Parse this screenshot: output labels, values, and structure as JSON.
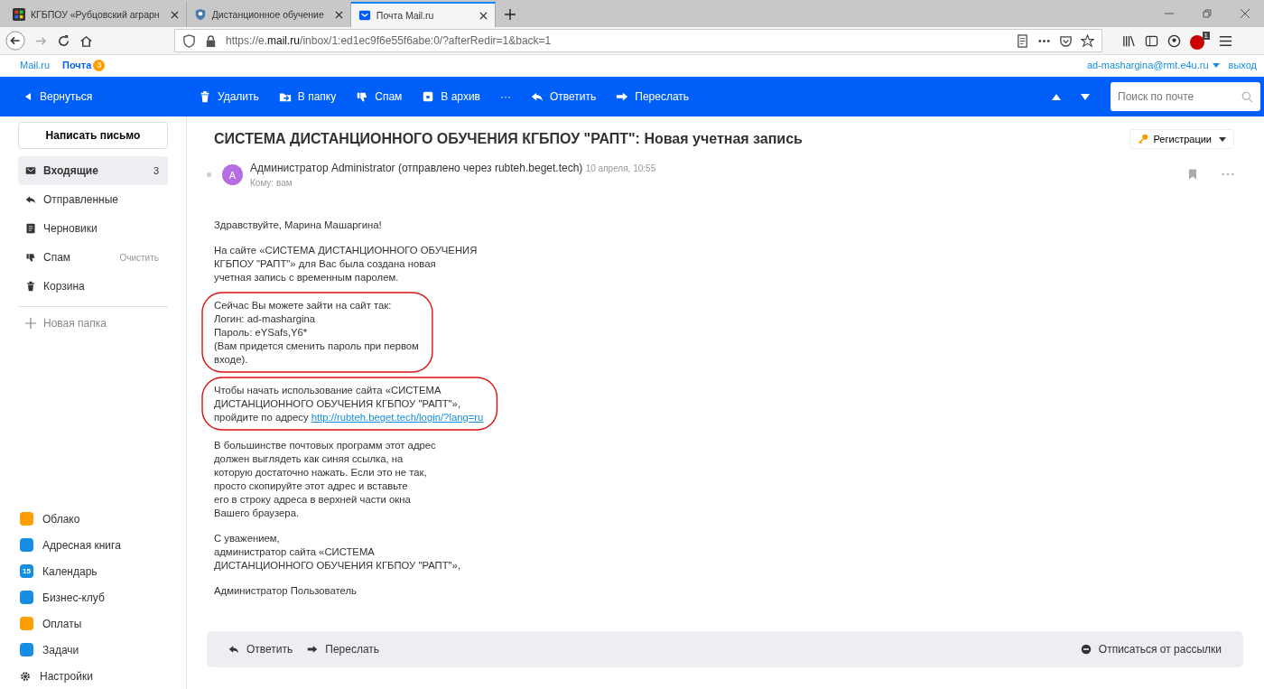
{
  "browser": {
    "tabs": [
      {
        "label": "КГБПОУ «Рубцовский аграрн",
        "selected": false
      },
      {
        "label": "Дистанционное обучение",
        "selected": false
      },
      {
        "label": "Почта Mail.ru",
        "selected": true
      }
    ],
    "url_prefix": "https://e.",
    "url_domain": "mail.ru",
    "url_rest": "/inbox/1:ed1ec9f6e55f6abe:0/?afterRedir=1&back=1",
    "adblock_badge": "1"
  },
  "portal": {
    "links": [
      {
        "label": "Mail.ru"
      },
      {
        "label": "Почта",
        "badge": "3"
      }
    ],
    "account": "ad-mashargina@rmt.e4u.ru",
    "logout": "выход"
  },
  "toolbar": {
    "back": "Вернуться",
    "actions": [
      {
        "label": "Удалить",
        "kind": "trash"
      },
      {
        "label": "В папку",
        "kind": "move"
      },
      {
        "label": "Спам",
        "kind": "spam"
      },
      {
        "label": "В архив",
        "kind": "archive"
      },
      {
        "label": "···",
        "kind": "more"
      },
      {
        "label": "Ответить",
        "kind": "reply"
      },
      {
        "label": "Переслать",
        "kind": "forward"
      }
    ],
    "search_placeholder": "Поиск по почте"
  },
  "sidebar": {
    "compose": "Написать письмо",
    "folders": [
      {
        "label": "Входящие",
        "kind": "inbox",
        "count": "3",
        "selected": true
      },
      {
        "label": "Отправленные",
        "kind": "sent",
        "selected": false
      },
      {
        "label": "Черновики",
        "kind": "drafts",
        "selected": false
      },
      {
        "label": "Спам",
        "kind": "spam",
        "action": "Очистить",
        "selected": false
      },
      {
        "label": "Корзина",
        "kind": "trash",
        "selected": false
      }
    ],
    "new_folder": "Новая папка",
    "services": [
      {
        "label": "Облако",
        "color": "#ff9e00"
      },
      {
        "label": "Адресная книга",
        "color": "#168de2"
      },
      {
        "label": "Календарь",
        "color": "#168de2",
        "glyph": "15"
      },
      {
        "label": "Бизнес-клуб",
        "color": "#168de2"
      },
      {
        "label": "Оплаты",
        "color": "#ff9e00"
      },
      {
        "label": "Задачи",
        "color": "#168de2"
      }
    ],
    "settings": "Настройки"
  },
  "message": {
    "subject": "СИСТЕМА ДИСТАНЦИОННОГО ОБУЧЕНИЯ КГБПОУ \"РАПТ\": Новая учетная запись",
    "category": "Регистрации",
    "avatar": "A",
    "sender": "Администратор Administrator (отправлено через rubteh.beget.tech)",
    "date": "10 апреля, 10:55",
    "to": "Кому: вам",
    "paragraphs": [
      {
        "lines": [
          "Здравствуйте, Марина Машаргина!"
        ],
        "annotated": false
      },
      {
        "lines": [
          "На сайте «СИСТЕМА ДИСТАНЦИОННОГО ОБУЧЕНИЯ",
          "КГБПОУ \"РАПТ\"» для Вас была создана новая",
          "учетная запись с временным паролем."
        ],
        "annotated": false
      },
      {
        "lines": [
          "Сейчас Вы можете зайти на сайт так:",
          "Логин: ad-mashargina",
          "Пароль: eYSafs,Y6*",
          "(Вам придется сменить пароль при первом",
          "входе)."
        ],
        "annotated": true
      },
      {
        "lines": [
          "Чтобы начать использование сайта «СИСТЕМА",
          "ДИСТАНЦИОННОГО ОБУЧЕНИЯ КГБПОУ \"РАПТ\"»,",
          "пройдите по адресу"
        ],
        "link": "http://rubteh.beget.tech/login/?lang=ru",
        "annotated": true
      },
      {
        "lines": [
          "В большинстве почтовых программ этот адрес",
          "должен выглядеть как синяя ссылка, на",
          "которую достаточно нажать. Если это не так,",
          "просто скопируйте этот адрес и вставьте",
          "его в строку адреса в верхней части окна",
          "Вашего браузера."
        ],
        "annotated": false
      },
      {
        "lines": [
          "С уважением,",
          "администратор сайта «СИСТЕМА",
          "ДИСТАНЦИОННОГО ОБУЧЕНИЯ КГБПОУ \"РАПТ\"»,"
        ],
        "annotated": false
      },
      {
        "lines": [
          "Администратор Пользователь"
        ],
        "annotated": false
      }
    ],
    "footer_actions": [
      {
        "label": "Ответить",
        "kind": "reply"
      },
      {
        "label": "Переслать",
        "kind": "forward"
      }
    ],
    "unsubscribe": "Отписаться от рассылки"
  }
}
